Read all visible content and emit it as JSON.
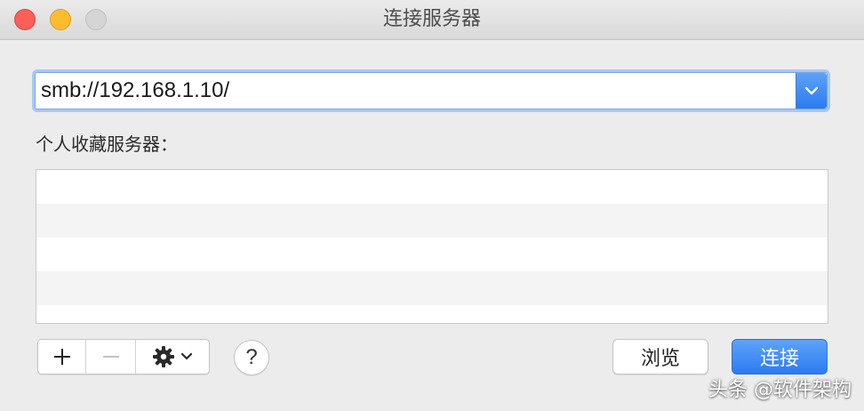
{
  "window": {
    "title": "连接服务器"
  },
  "server_address": {
    "value": "smb://192.168.1.10/"
  },
  "favorites": {
    "label": "个人收藏服务器：",
    "rows": [
      "",
      "",
      "",
      ""
    ]
  },
  "toolbar": {
    "add_icon": "plus-icon",
    "remove_icon": "minus-icon",
    "action_icon": "gear-icon",
    "help_label": "?"
  },
  "buttons": {
    "browse_label": "浏览",
    "connect_label": "连接"
  },
  "watermark": {
    "text": "头条 @软件架构"
  },
  "colors": {
    "accent": "#2b7bf0",
    "close": "#fc5f57",
    "minimize": "#fdbc2e",
    "zoom_inactive": "#d5d5d5"
  }
}
